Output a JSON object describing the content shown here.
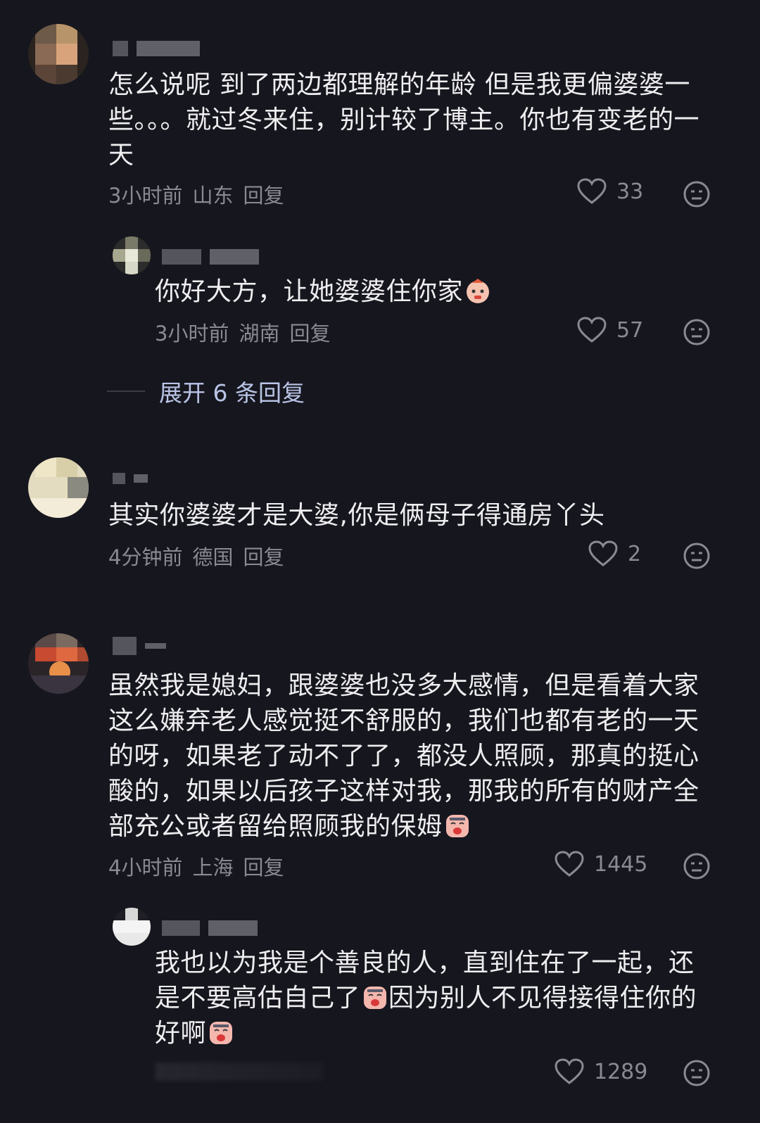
{
  "comments": [
    {
      "text": "怎么说呢 到了两边都理解的年龄 但是我更偏婆婆一些。。。就过冬来住，别计较了博主。你也有变老的一天",
      "time": "3小时前",
      "location": "山东",
      "reply_label": "回复",
      "likes": "33"
    },
    {
      "text": "你好大方，让她婆婆住你家",
      "emoji": "face-emoji",
      "time": "3小时前",
      "location": "湖南",
      "reply_label": "回复",
      "likes": "57"
    },
    {
      "text": "其实你婆婆才是大婆,你是俩母子得通房丫头",
      "time": "4分钟前",
      "location": "德国",
      "reply_label": "回复",
      "likes": "2"
    },
    {
      "text": "虽然我是媳妇，跟婆婆也没多大感情，但是看着大家这么嫌弃老人感觉挺不舒服的，我们也都有老的一天的呀，如果老了动不了了，都没人照顾，那真的挺心酸的，如果以后孩子这样对我，那我的所有的财产全部充公或者留给照顾我的保姆",
      "time": "4小时前",
      "location": "上海",
      "reply_label": "回复",
      "likes": "1445"
    },
    {
      "text_a": "我也以为我是个善良的人，直到住在了一起，还是不要高估自己了",
      "text_b": "因为别人不见得接得住你的好啊",
      "likes": "1289"
    }
  ],
  "expand_replies": "展开 6 条回复",
  "colors": {
    "background": "#16161e",
    "text": "#eeeef0",
    "meta": "#8a8a92",
    "expand": "#b9c4e6"
  }
}
